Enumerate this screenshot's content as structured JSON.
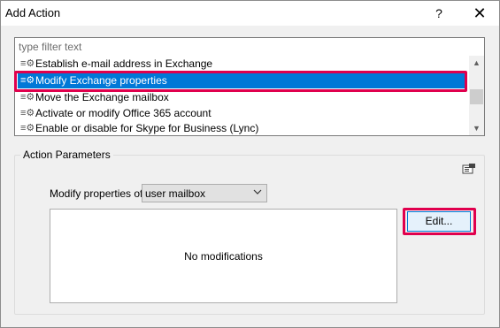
{
  "window": {
    "title": "Add Action",
    "help_glyph": "?",
    "close_glyph": "✕"
  },
  "filter": {
    "placeholder": "type filter text",
    "value": ""
  },
  "actions": {
    "items": [
      {
        "label": "Establish e-mail address in Exchange",
        "selected": false
      },
      {
        "label": "Modify Exchange properties",
        "selected": true
      },
      {
        "label": "Move the Exchange mailbox",
        "selected": false
      },
      {
        "label": "Activate or modify Office 365 account",
        "selected": false
      },
      {
        "label": "Enable or disable for Skype for Business (Lync)",
        "selected": false
      }
    ],
    "item_icon": "gear-icon",
    "selection_color": "#0078d7"
  },
  "params": {
    "group_label": "Action Parameters",
    "modify_label": "Modify properties of",
    "target_value": "user mailbox",
    "empty_text": "No modifications",
    "edit_label": "Edit..."
  },
  "highlight_color": "#e0004d"
}
